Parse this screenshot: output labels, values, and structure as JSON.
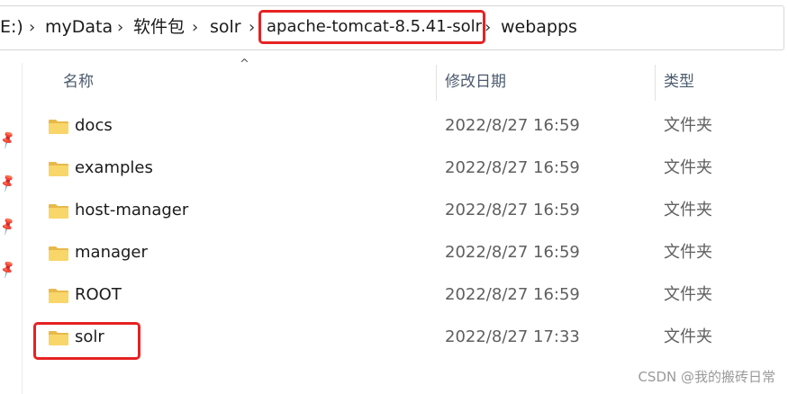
{
  "address_bar": {
    "crumbs": [
      "E:)",
      "myData",
      "软件包",
      "solr",
      "apache-tomcat-8.5.41-solr",
      "webapps"
    ],
    "separator": "›"
  },
  "columns": {
    "name": "名称",
    "modified": "修改日期",
    "type": "类型"
  },
  "files": [
    {
      "name": "docs",
      "modified": "2022/8/27 16:59",
      "type": "文件夹"
    },
    {
      "name": "examples",
      "modified": "2022/8/27 16:59",
      "type": "文件夹"
    },
    {
      "name": "host-manager",
      "modified": "2022/8/27 16:59",
      "type": "文件夹"
    },
    {
      "name": "manager",
      "modified": "2022/8/27 16:59",
      "type": "文件夹"
    },
    {
      "name": "ROOT",
      "modified": "2022/8/27 16:59",
      "type": "文件夹"
    },
    {
      "name": "solr",
      "modified": "2022/8/27 17:33",
      "type": "文件夹"
    }
  ],
  "watermark": "CSDN @我的搬砖日常",
  "colors": {
    "highlight": "#e62222",
    "folder_fill": "#f8d66a",
    "folder_tab": "#e8b94a"
  },
  "icons": {
    "folder": "folder-icon",
    "pin": "pin-icon",
    "sort": "sort-ascending-icon"
  }
}
